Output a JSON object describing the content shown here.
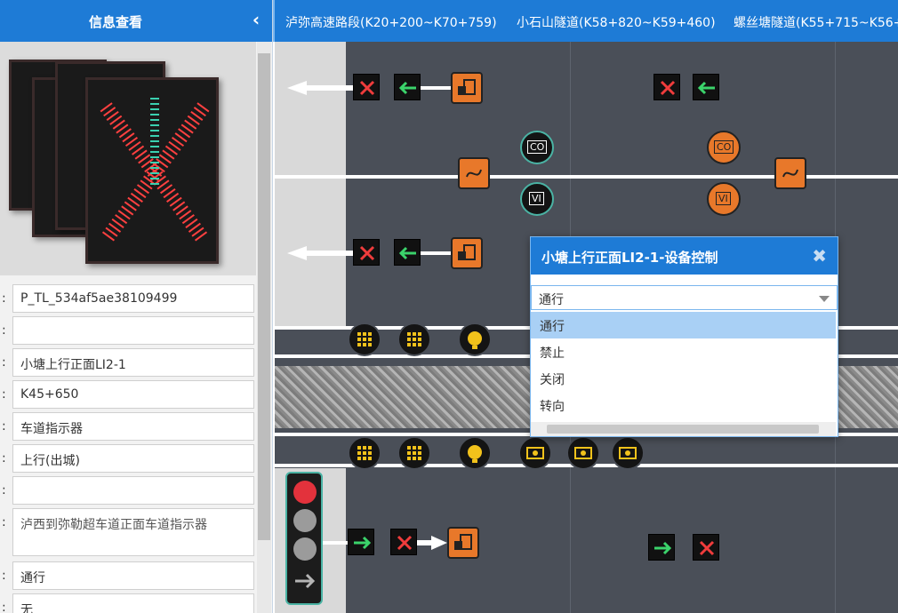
{
  "left_panel": {
    "title": "信息查看",
    "collapse_icon": "chevron-left-icon",
    "fields": [
      "P_TL_534af5ae38109499",
      "",
      "小塘上行正面LI2-1",
      "K45+650",
      "车道指示器",
      "上行(出城)",
      "",
      "泸西到弥勒超车道正面车道指示器",
      "通行",
      "无"
    ]
  },
  "tabs": [
    "泸弥高速路段(K20+200~K70+759)",
    "小石山隧道(K58+820~K59+460)",
    "螺丝塘隧道(K55+715~K56+"
  ],
  "map": {
    "co_label": "CO",
    "vi_label": "VI"
  },
  "modal": {
    "title": "小塘上行正面LI2-1-设备控制",
    "close_icon": "close-icon",
    "selected": "通行",
    "options": [
      "通行",
      "禁止",
      "关闭",
      "转向"
    ]
  },
  "colors": {
    "brand": "#1e7bd6",
    "road": "#4a4f58",
    "device_orange": "#e8782a",
    "device_teal": "#4ab3a4"
  }
}
